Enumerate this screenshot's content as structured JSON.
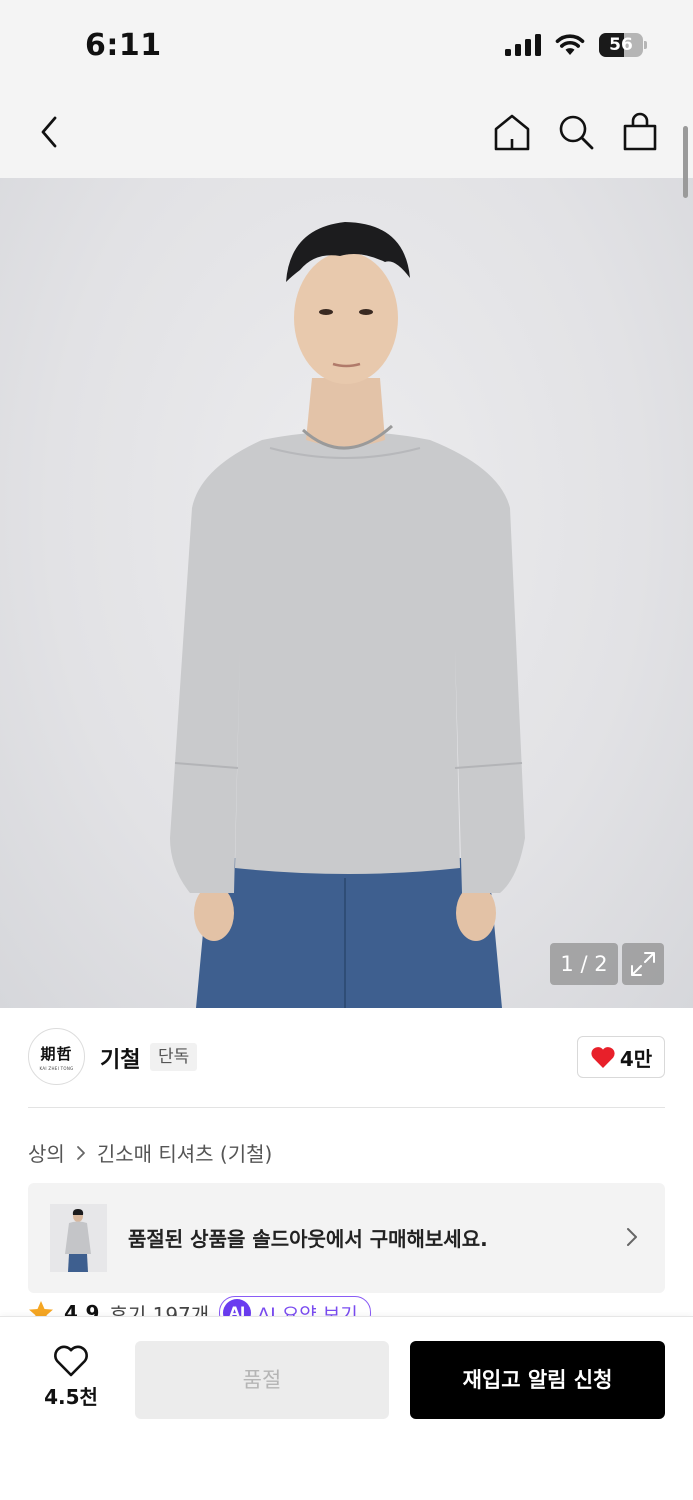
{
  "status_bar": {
    "time": "6:11",
    "battery": "56",
    "battery_level": 0.56,
    "icons": [
      "cellular-signal-icon",
      "wifi-icon",
      "battery-icon"
    ]
  },
  "nav": {
    "icons": [
      "back-icon",
      "home-icon",
      "search-icon",
      "shopping-bag-icon"
    ]
  },
  "gallery": {
    "counter": "1 / 2",
    "current": 1,
    "total": 2,
    "expand_icon": "expand-icon"
  },
  "brand": {
    "name": "기철",
    "tag": "단독",
    "logo_text": "期哲",
    "logo_subtext": "KAI ZHEI TONG",
    "like_count": "4만",
    "like_icon": "heart-filled-icon",
    "like_color": "#e8202a"
  },
  "breadcrumb": {
    "items": [
      "상의",
      "긴소매 티셔츠 (기철)"
    ],
    "separator_icon": "chevron-right-icon"
  },
  "soldout_banner": {
    "text": "품절된 상품을 솔드아웃에서 구매해보세요.",
    "icon": "chevron-right-icon"
  },
  "rating": {
    "score": "4.9",
    "reviews": "후기 197개",
    "ai_badge": "AI",
    "ai_label": "AI 요약 보기",
    "star_color": "#f5a623"
  },
  "bottom_bar": {
    "wish_count": "4.5천",
    "soldout_label": "품절",
    "restock_label": "재입고 알림 신청"
  },
  "colors": {
    "accent_black": "#000000",
    "status_bar_bg": "#f4f4f4",
    "ai_purple": "#6a3cf0"
  }
}
